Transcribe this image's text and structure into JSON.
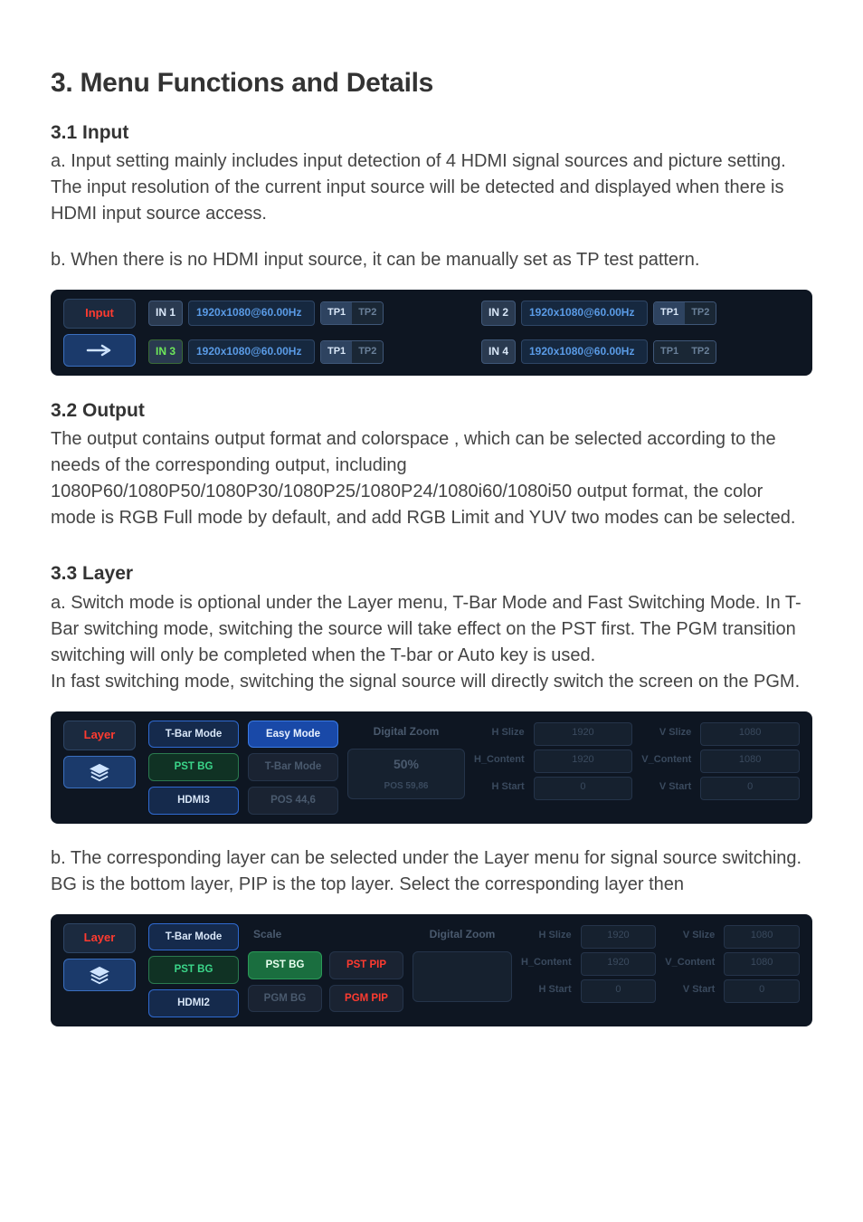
{
  "title": "3. Menu Functions and Details",
  "s31": {
    "head": "3.1 Input",
    "pa": "a. Input setting mainly includes input detection of 4 HDMI signal sources and picture setting. The input resolution of the current input source will be detected and displayed when there is HDMI input source access.",
    "pb": "b. When there is no HDMI input source, it can be manually set as TP test pattern."
  },
  "input_panel": {
    "tab": "Input",
    "rows": [
      {
        "in": "IN 1",
        "green": false,
        "res": "1920x1080@60.00Hz",
        "tp1": "TP1",
        "tp2": "TP2",
        "tp1_active": true
      },
      {
        "in": "IN 2",
        "green": false,
        "res": "1920x1080@60.00Hz",
        "tp1": "TP1",
        "tp2": "TP2",
        "tp1_active": true
      },
      {
        "in": "IN 3",
        "green": true,
        "res": "1920x1080@60.00Hz",
        "tp1": "TP1",
        "tp2": "TP2",
        "tp1_active": true
      },
      {
        "in": "IN 4",
        "green": false,
        "res": "1920x1080@60.00Hz",
        "tp1": "TP1",
        "tp2": "TP2",
        "tp1_active": false
      }
    ]
  },
  "s32": {
    "head": "3.2 Output",
    "p": "The output contains output format and colorspace , which can be selected according to the needs of the corresponding output, including 1080P60/1080P50/1080P30/1080P25/1080P24/1080i60/1080i50 output format, the color mode is RGB Full mode by default, and add RGB Limit and YUV two modes can be selected."
  },
  "s33": {
    "head": "3.3 Layer",
    "pa": "a. Switch mode is optional under the Layer menu, T-Bar Mode and Fast Switching Mode. In T-Bar switching mode, switching the source will take effect on the PST first. The PGM transition switching will only be completed when the T-bar or Auto key is used.",
    "pb": "In fast switching mode, switching the signal source will directly switch the screen on the PGM.",
    "pc": "b. The corresponding layer can be selected under the Layer menu for signal source switching.",
    "pd": "BG is the bottom layer, PIP is the top layer. Select the corresponding layer then"
  },
  "layer1": {
    "tab": "Layer",
    "col1": [
      "T-Bar Mode",
      "PST BG",
      "HDMI3"
    ],
    "col2": [
      "Easy Mode",
      "T-Bar Mode",
      "POS 44,6"
    ],
    "zoom_head": "Digital Zoom",
    "zoom_v": "50%",
    "zoom_sub": "POS 59,86",
    "stats": {
      "H Slize": "1920",
      "V Slize": "1080",
      "H_Content": "1920",
      "V_Content": "1080",
      "H Start": "0",
      "V Start": "0"
    }
  },
  "layer2": {
    "tab": "Layer",
    "col1": [
      "T-Bar Mode",
      "PST BG",
      "HDMI2"
    ],
    "col2_head": "Scale",
    "col2_a": [
      "PST BG",
      "PGM BG"
    ],
    "col2_b": [
      "PST PIP",
      "PGM PIP"
    ],
    "zoom_head": "Digital Zoom",
    "stats": {
      "H Slize": "1920",
      "V Slize": "1080",
      "H_Content": "1920",
      "V_Content": "1080",
      "H Start": "0",
      "V Start": "0"
    }
  }
}
